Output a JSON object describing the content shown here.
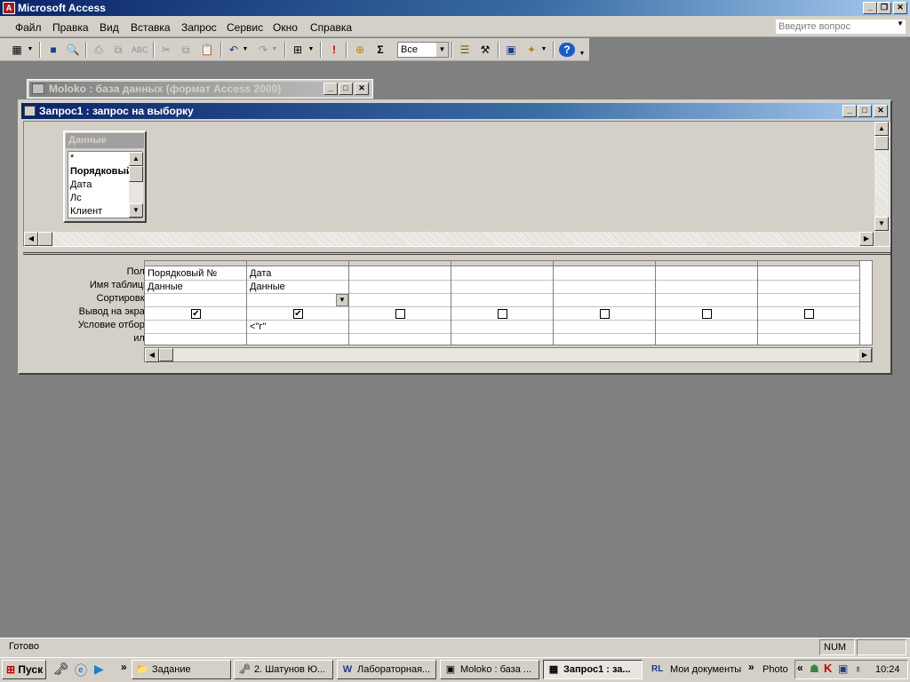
{
  "app": {
    "title": "Microsoft Access"
  },
  "menu": [
    "Файл",
    "Правка",
    "Вид",
    "Вставка",
    "Запрос",
    "Сервис",
    "Окно",
    "Справка"
  ],
  "help_box": {
    "placeholder": "Введите вопрос"
  },
  "toolbar": {
    "top_values": "Все"
  },
  "db_window": {
    "title": "Moloko : база данных (формат Access 2000)"
  },
  "query_window": {
    "title": "Запрос1 : запрос на выборку"
  },
  "field_list": {
    "title": "Данные",
    "fields": [
      "*",
      "Порядковый",
      "Дата",
      "Лс",
      "Клиент"
    ]
  },
  "grid": {
    "row_labels": [
      "Поле:",
      "Имя таблицы:",
      "Сортировка:",
      "Вывод на экран:",
      "Условие отбора:",
      "или:"
    ],
    "columns": [
      {
        "field": "Порядковый №",
        "table": "Данные",
        "sort": "",
        "show": true,
        "criteria": ""
      },
      {
        "field": "Дата",
        "table": "Данные",
        "sort": "",
        "show": true,
        "criteria": "<\"г\""
      },
      {
        "field": "",
        "table": "",
        "sort": "",
        "show": false,
        "criteria": ""
      },
      {
        "field": "",
        "table": "",
        "sort": "",
        "show": false,
        "criteria": ""
      },
      {
        "field": "",
        "table": "",
        "sort": "",
        "show": false,
        "criteria": ""
      },
      {
        "field": "",
        "table": "",
        "sort": "",
        "show": false,
        "criteria": ""
      },
      {
        "field": "",
        "table": "",
        "sort": "",
        "show": false,
        "criteria": ""
      }
    ]
  },
  "status": {
    "text": "Готово",
    "num": "NUM"
  },
  "taskbar": {
    "start": "Пуск",
    "buttons": [
      {
        "label": "Задание",
        "icon": "folder-icon"
      },
      {
        "label": "2. Шатунов Ю...",
        "icon": "key-icon"
      },
      {
        "label": "Лабораторная...",
        "icon": "word-icon"
      },
      {
        "label": "Moloko : база ...",
        "icon": "access-icon"
      },
      {
        "label": "Запрос1 : за...",
        "icon": "query-icon"
      }
    ],
    "extra": [
      "RL",
      "Мои документы",
      "Photo"
    ],
    "time": "10:24"
  },
  "colors": {
    "titlebar": "#0a246a",
    "desktop": "#808080",
    "face": "#d4d0c8"
  }
}
